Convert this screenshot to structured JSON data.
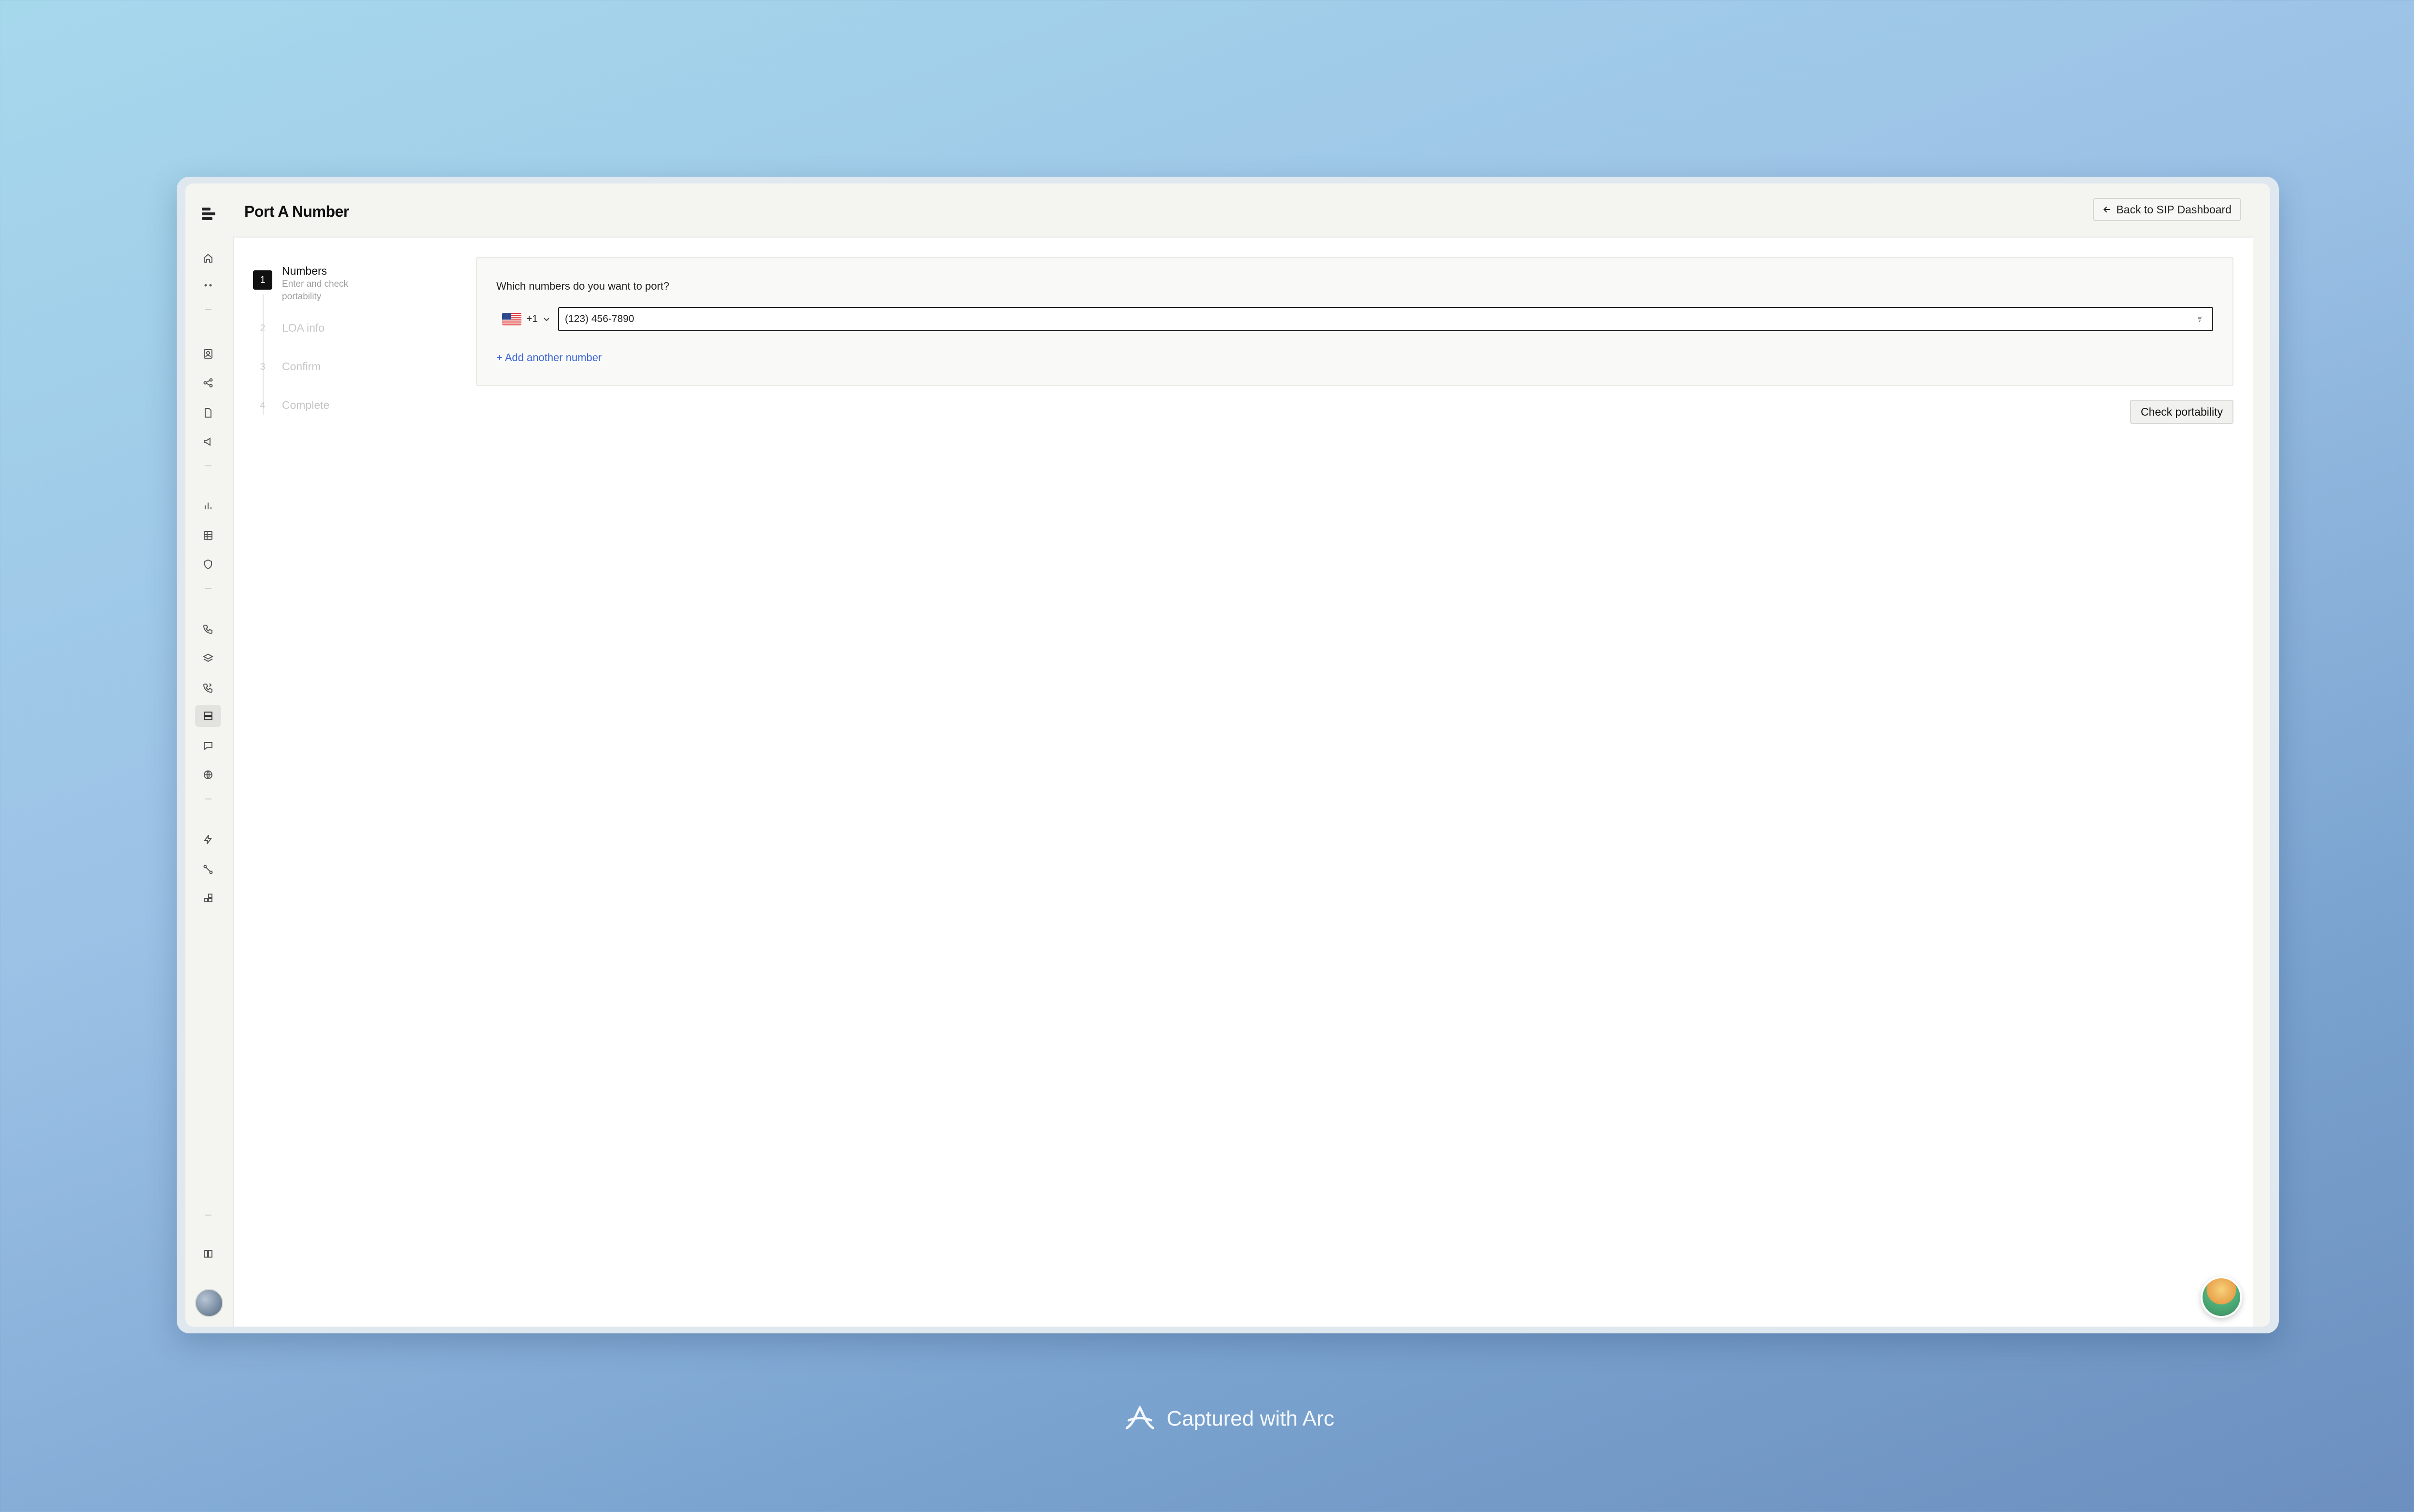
{
  "page": {
    "title": "Port A Number",
    "back_button_label": "Back to SIP Dashboard"
  },
  "sidebar": {
    "icons": [
      "home-icon",
      "more-icon",
      "contacts-icon",
      "share-icon",
      "document-icon",
      "megaphone-icon",
      "bar-chart-icon",
      "table-icon",
      "shield-icon",
      "phone-call-icon",
      "layers-icon",
      "phone-forward-icon",
      "server-icon",
      "message-icon",
      "globe-icon",
      "bolt-icon",
      "phone-route-icon",
      "blocks-icon",
      "book-icon"
    ],
    "active": "server-icon"
  },
  "stepper": {
    "steps": [
      {
        "number": "1",
        "title": "Numbers",
        "subtitle": "Enter and check portability",
        "state": "current"
      },
      {
        "number": "2",
        "title": "LOA info",
        "state": "upcoming"
      },
      {
        "number": "3",
        "title": "Confirm",
        "state": "upcoming"
      },
      {
        "number": "4",
        "title": "Complete",
        "state": "upcoming"
      }
    ]
  },
  "form": {
    "question": "Which numbers do you want to port?",
    "country_code": "+1",
    "phone_value": "(123) 456-7890",
    "add_another_label": "+ Add another number",
    "submit_label": "Check portability"
  },
  "footer": {
    "capture_text": "Captured with Arc"
  }
}
